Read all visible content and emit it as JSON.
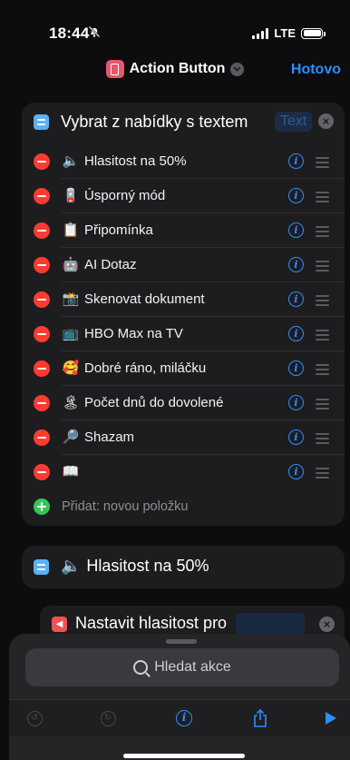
{
  "status": {
    "time": "18:44",
    "network": "LTE"
  },
  "nav": {
    "title": "Action Button",
    "done": "Hotovo"
  },
  "menu_card": {
    "title": "Vybrat z nabídky s textem",
    "token": "Text",
    "items": [
      {
        "emoji": "🔈",
        "label": "Hlasitost na 50%"
      },
      {
        "emoji": "🪫",
        "label": "Úsporný mód"
      },
      {
        "emoji": "📋",
        "label": "Připomínka"
      },
      {
        "emoji": "🤖",
        "label": "AI Dotaz"
      },
      {
        "emoji": "📸",
        "label": "Skenovat dokument"
      },
      {
        "emoji": "📺",
        "label": "HBO Max na TV"
      },
      {
        "emoji": "🥰",
        "label": "Dobré ráno, miláčku"
      },
      {
        "emoji": "🏝",
        "label": "Počet dnů do dovolené"
      },
      {
        "emoji": "🔎",
        "label": "Shazam"
      },
      {
        "emoji": "📖",
        "label": ""
      }
    ],
    "add_label": "Přidat: novou položku"
  },
  "case_card": {
    "emoji": "🔈",
    "title": "Hlasitost na 50%"
  },
  "volume_card": {
    "title": "Nastavit hlasitost pro"
  },
  "search": {
    "placeholder": "Hledat akce"
  },
  "colors": {
    "accent": "#2e8cff",
    "minus": "#ff3b30",
    "plus": "#34c759",
    "card": "#1d1d20"
  }
}
